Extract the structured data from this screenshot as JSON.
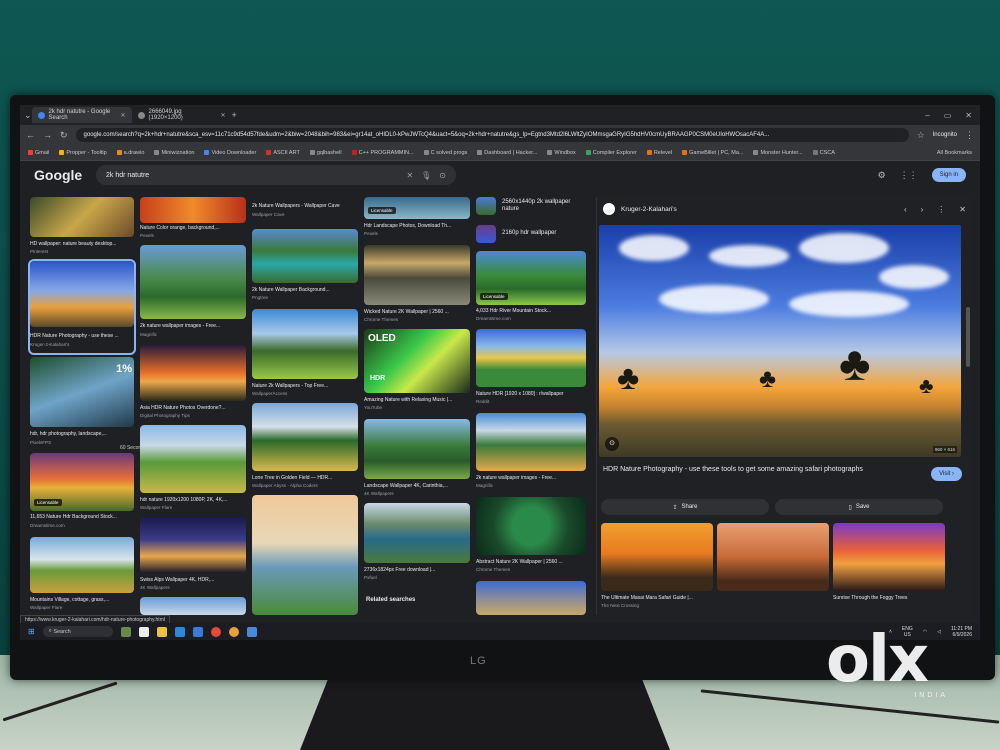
{
  "browser": {
    "tabs": [
      {
        "label": "2k hdr natutre - Google Search",
        "active": true
      },
      {
        "label": "2666049.jpg (1920×1200)",
        "active": false
      }
    ],
    "url": "google.com/search?q=2k+hdr+natutre&sca_esv=11c71c9d54d57fde&udm=2&biw=2048&bih=983&ei=gr14at_oHIDL0-kPwJWTcQ4&uact=5&oq=2k+hdr+natutre&gs_lp=Egtnd3Mtd2l6LWltZyIOMmsgaGRyIG5hdHV0cmUyBRAAGP0CSM0eUIoHWOsacAF4A...",
    "incognito_label": "Incognito",
    "bookmarks": [
      "Gmail",
      "Propper - Tooltip",
      "a.drawio",
      "Miniwiznation",
      "Video Downloader",
      "ASCII ART",
      "gqlbashell",
      "C++ PROGRAMMIN...",
      "C solved progs",
      "Dashboard | Hacker...",
      "Windbox",
      "Compiler Explorer",
      "Relevel",
      "GameBillet | PC, Ma...",
      "Monster Hunter...",
      "CSCA"
    ],
    "all_bookmarks": "All Bookmarks"
  },
  "google": {
    "logo": "Google",
    "query": "2k hdr natutre",
    "signin": "Sign in"
  },
  "results": {
    "col1": [
      {
        "title": "HD wallpaper: nature beauty desktop...",
        "source": "Pinterest"
      },
      {
        "title": "HDR Nature Photography - use these ...",
        "source": "Kruger-2-Kalahari's"
      },
      {
        "title": "hdr, hdr photography, landscape,...",
        "source": "PixelsFPS"
      },
      {
        "title": "11,653 Nature Hdr Background Stock...",
        "source": "Dreamstime.com",
        "badge": "Licensable"
      },
      {
        "title": "Mountains Village, cottage, grass,...",
        "source": "Wallpaper Flare"
      }
    ],
    "col1_overlay": {
      "percent": "1%",
      "seconds": "60 Seconds"
    },
    "col2": [
      {
        "title": "Nature Color orange, background,...",
        "source": "Pexels"
      },
      {
        "title": "2k nature wallpaper images - Free...",
        "source": "Magnific"
      },
      {
        "title": "Asia HDR Nature Photos Overdone?...",
        "source": "Digital Photography Tips"
      },
      {
        "title": "hdr nature 1920x1200 1080P, 2K, 4K,...",
        "source": "Wallpaper Flare"
      },
      {
        "title": "Swiss Alps Wallpaper 4K, HDR,...",
        "source": "4K Wallpapers"
      }
    ],
    "col3": [
      {
        "title": "2k Nature Wallpapers - Wallpaper Cave",
        "source": "Wallpaper Cave"
      },
      {
        "title": "2k Nature Wallpaper Background...",
        "source": "Pngtree"
      },
      {
        "title": "Nature 2k Wallpapers - Top Free...",
        "source": "WallpaperAccess"
      },
      {
        "title": "Lone Tree in Golden Field — HDR...",
        "source": "Wallpaper Abyss - Alpha Coders"
      },
      {
        "title": "",
        "source": ""
      }
    ],
    "col4": [
      {
        "title": "Hdr Landscape Photos, Download Th...",
        "source": "Pexels",
        "badge": "Licensable"
      },
      {
        "title": "Wicked Nature 2K Wallpaper | 2560 ...",
        "source": "Chrome Themes"
      },
      {
        "title": "Amazing Nature with Relaxing Music |...",
        "source": "YouTube"
      },
      {
        "title": "Landscape Wallpaper 4K, Carinthia,...",
        "source": "4K Wallpapers"
      },
      {
        "title": "2736x1824px Free download |...",
        "source": "Pxfuel"
      }
    ],
    "col4_overlay": {
      "oled": "OLED",
      "hdr": "HDR"
    },
    "col5": [
      {
        "title": "2560x1440p 2k wallpaper nature",
        "source": ""
      },
      {
        "title": "2160p hdr wallpaper",
        "source": ""
      },
      {
        "title": "4,033 Hdr River Mountain Stock...",
        "source": "Dreamstime.com",
        "badge": "Licensable"
      },
      {
        "title": "Nature HDR [1920 x 1080] : r/wallpaper",
        "source": "Reddit"
      },
      {
        "title": "2k nature wallpaper images - Free...",
        "source": "Magnific"
      },
      {
        "title": "Abstract Nature 2K Wallpaper | 2560 ...",
        "source": "Chrome Themes"
      }
    ],
    "related_searches": "Related searches"
  },
  "panel": {
    "site": "Kruger-2-Kalahari's",
    "dims": "960 × 616",
    "title": "HDR Nature Photography - use these tools to get some amazing safari photographs",
    "visit": "Visit",
    "share": "Share",
    "save": "Save",
    "related": [
      {
        "title": "The Ultimate Masai Mara Safari Guide |...",
        "source": "The Next Crossing"
      },
      {
        "title": "",
        "source": ""
      },
      {
        "title": "Sunrise Through the Foggy Trees",
        "source": ""
      }
    ]
  },
  "status_url": "https://www.kruger-2-kalahari.com/hdr-nature-photography.html",
  "taskbar": {
    "search": "Search",
    "lang": "ENG",
    "region": "US",
    "time": "11:21 PM",
    "date": "6/9/2026"
  },
  "monitor_brand": "LG",
  "watermark": {
    "word": "olx",
    "sub": "INDIA"
  }
}
